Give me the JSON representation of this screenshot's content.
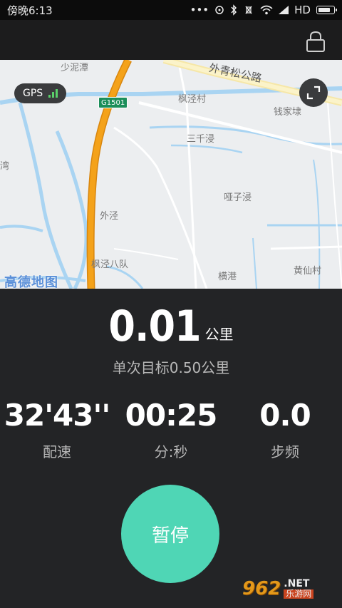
{
  "status_bar": {
    "time": "傍晚6:13",
    "dots": "•••",
    "network": "HD",
    "icons": [
      "sync-icon",
      "bluetooth-icon",
      "vibrate-off-icon",
      "wifi-icon",
      "signal-icon",
      "battery-icon"
    ]
  },
  "header": {
    "lock_icon": "lock-icon"
  },
  "map": {
    "gps_label": "GPS",
    "road_label": "外青松公路",
    "highway_badge": "G1501",
    "places": [
      {
        "name": "少泥潭"
      },
      {
        "name": "枫泾村"
      },
      {
        "name": "钱家埭"
      },
      {
        "name": "三千浸"
      },
      {
        "name": "哑子浸"
      },
      {
        "name": "外泾"
      },
      {
        "name": "枫泾八队"
      },
      {
        "name": "横港"
      },
      {
        "name": "黄仙村"
      },
      {
        "name": "湾"
      }
    ],
    "logo": "高德地图",
    "expand_icon": "expand-icon"
  },
  "run": {
    "distance": "0.01",
    "distance_unit": "公里",
    "goal": "单次目标0.50公里",
    "stats": [
      {
        "value": "32'43''",
        "label": "配速"
      },
      {
        "value": "00:25",
        "label": "分:秒"
      },
      {
        "value": "0.0",
        "label": "步频"
      }
    ],
    "pause_label": "暂停"
  },
  "watermark": {
    "number": "962",
    "net": ".NET",
    "cn": "乐游网"
  },
  "colors": {
    "accent": "#4fd6b5",
    "background": "#232426",
    "highway": "#f4a21a"
  }
}
